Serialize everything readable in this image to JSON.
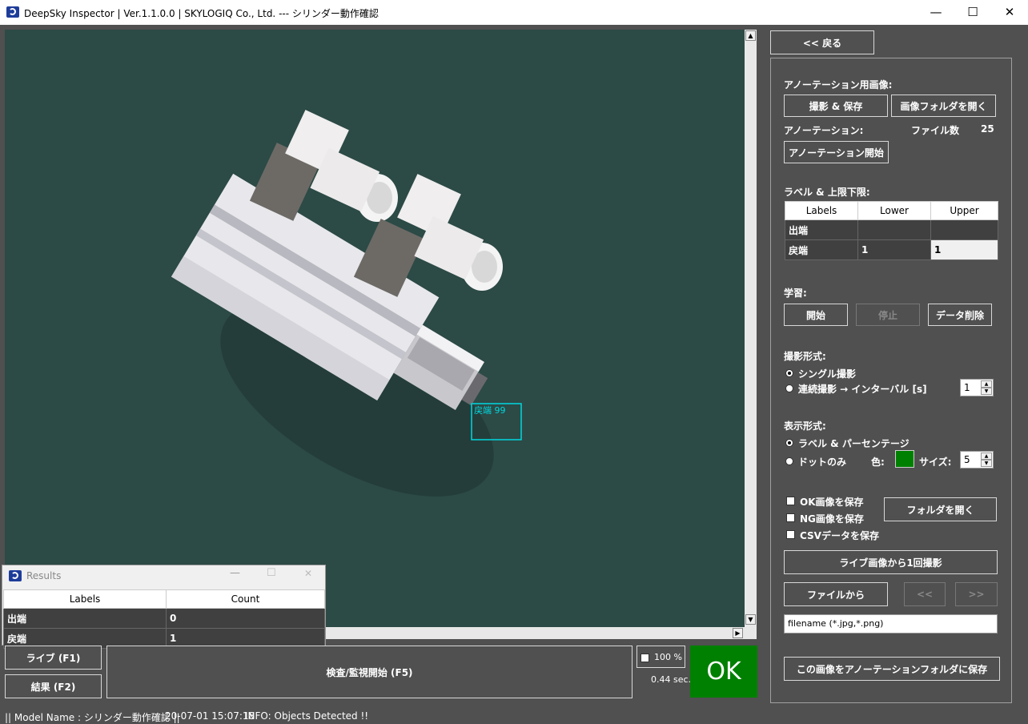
{
  "window": {
    "title": "DeepSky Inspector | Ver.1.1.0.0 | SKYLOGIQ Co., Ltd. --- シリンダー動作確認",
    "minimize": "—",
    "maximize": "☐",
    "close": "✕"
  },
  "viewer": {
    "detection_label": "戻端 99",
    "colors": {
      "background": "#2c4a46",
      "detection_box": "#00d8e0"
    }
  },
  "controls": {
    "back_label": "<< 戻る",
    "live_label": "ライブ (F1)",
    "result_label": "結果 (F2)",
    "inspect_label": "検査/監視開始 (F5)",
    "zoom_label": "100 %",
    "elapsed": "0.44 sec.",
    "judgement": "OK",
    "judgement_color": "#008000"
  },
  "panel": {
    "annot_image_heading": "アノーテーション用画像:",
    "capture_save": "撮影 & 保存",
    "open_image_folder": "画像フォルダを開く",
    "annotation_heading": "アノーテーション:",
    "file_count_label": "ファイル数",
    "file_count": "25",
    "start_annotation": "アノーテーション開始",
    "label_limits_heading": "ラベル & 上限下限:",
    "limits_table": {
      "headers": [
        "Labels",
        "Lower",
        "Upper"
      ],
      "rows": [
        {
          "label": "出端",
          "lower": "",
          "upper": ""
        },
        {
          "label": "戻端",
          "lower": "1",
          "upper": "1"
        }
      ]
    },
    "learning_heading": "学習:",
    "learn_start": "開始",
    "learn_stop": "停止",
    "learn_delete": "データ削除",
    "capture_mode_heading": "撮影形式:",
    "single_capture": "シングル撮影",
    "continuous_capture": "連続撮影 → インターバル [s]",
    "interval_value": "1",
    "display_mode_heading": "表示形式:",
    "label_percentage": "ラベル & パーセンテージ",
    "dots_only": "ドットのみ",
    "color_label": "色:",
    "dot_color": "#008000",
    "size_label": "サイズ:",
    "size_value": "5",
    "save_ok": "OK画像を保存",
    "save_ng": "NG画像を保存",
    "save_csv": "CSVデータを保存",
    "open_folder": "フォルダを開く",
    "capture_once": "ライブ画像から1回撮影",
    "from_file": "ファイルから",
    "prev": "<<",
    "next": ">>",
    "filename_placeholder": "filename (*.jpg,*.png)",
    "save_to_annotation": "この画像をアノーテーションフォルダに保存"
  },
  "results": {
    "title": "Results",
    "headers": [
      "Labels",
      "Count"
    ],
    "rows": [
      {
        "label": "出端",
        "count": "0"
      },
      {
        "label": "戻端",
        "count": "1"
      }
    ]
  },
  "status": {
    "model": "|| Model Name : シリンダー動作確認 ||",
    "timestamp": "20-07-01 15:07:18",
    "info": "INFO:   Objects Detected !!"
  }
}
